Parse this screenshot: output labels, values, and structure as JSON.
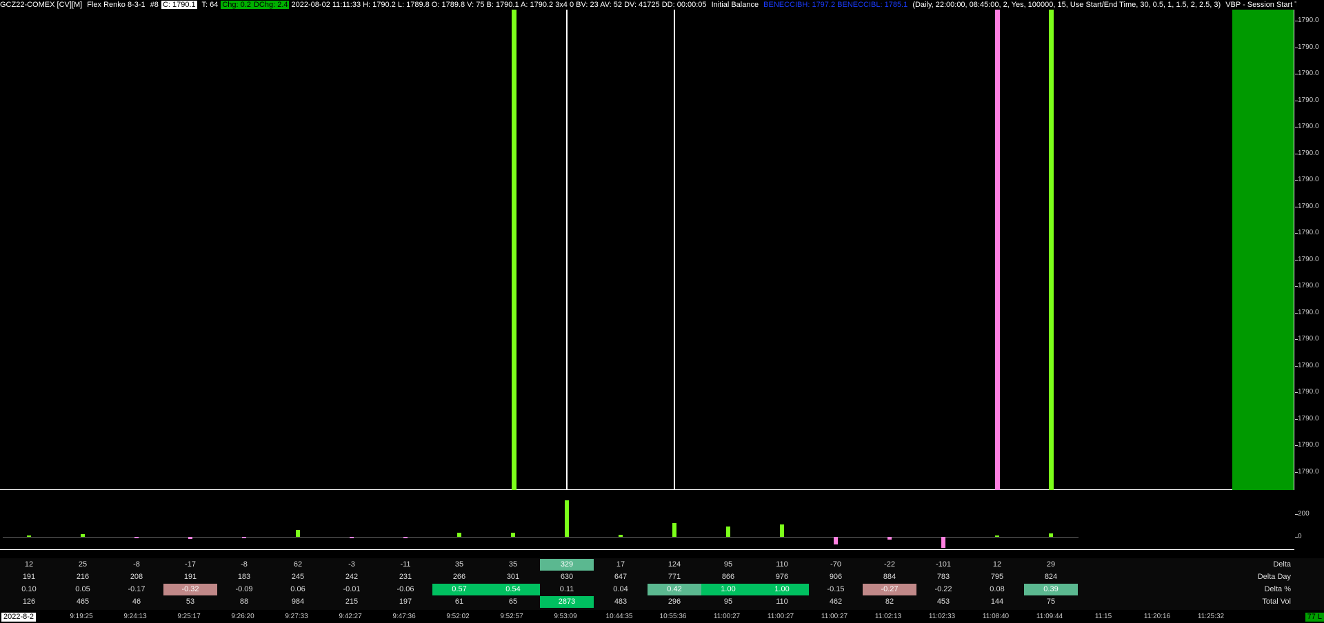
{
  "header": {
    "symbol": "GCZ22-COMEX [CV][M]",
    "chart_type": "Flex Renko 8-3-1",
    "chart_num": "#8",
    "close": "C: 1790.1",
    "ticks": "T: 64",
    "chg": "Chg: 0.2",
    "dchg": "DChg: 2.4",
    "stats": "2022-08-02 11:11:33 H: 1790.2 L: 1789.8 O: 1789.8 V: 75 B: 1790.1 A: 1790.2 3x4 0 BV: 23 AV: 52 DV: 41725 DD: 00:00:05",
    "study1": "Initial Balance",
    "study1_values": "BENECCIBH: 1797.2 BENECCIBL: 1785.1",
    "study2": "(Daily, 22:00:00, 08:45:00, 2, Yes, 100000, 15, Use Start/End Time, 30, 0.5, 1, 1.5, 2, 2.5, 3)",
    "study3": "VBP - Session Start Time to End"
  },
  "price_axis": {
    "label": "1790.0",
    "count": 18
  },
  "delta_axis": {
    "labels": [
      "200",
      "0"
    ]
  },
  "colors": {
    "up": "#7cff1a",
    "down": "#ff80e0",
    "profile": "#009a00",
    "pos_strong": "#00c060",
    "pos_weak": "#5bb890",
    "neg": "#c08888"
  },
  "table": {
    "row_labels": [
      "Delta",
      "Delta Day",
      "Delta %",
      "Total Vol"
    ],
    "columns": [
      {
        "delta": "12",
        "delta_day": "191",
        "delta_pct": "0.10",
        "total_vol": "126"
      },
      {
        "delta": "25",
        "delta_day": "216",
        "delta_pct": "0.05",
        "total_vol": "465"
      },
      {
        "delta": "-8",
        "delta_day": "208",
        "delta_pct": "-0.17",
        "total_vol": "46"
      },
      {
        "delta": "-17",
        "delta_day": "191",
        "delta_pct": "-0.32",
        "total_vol": "53",
        "pct_hl": "neg"
      },
      {
        "delta": "-8",
        "delta_day": "183",
        "delta_pct": "-0.09",
        "total_vol": "88"
      },
      {
        "delta": "62",
        "delta_day": "245",
        "delta_pct": "0.06",
        "total_vol": "984"
      },
      {
        "delta": "-3",
        "delta_day": "242",
        "delta_pct": "-0.01",
        "total_vol": "215"
      },
      {
        "delta": "-11",
        "delta_day": "231",
        "delta_pct": "-0.06",
        "total_vol": "197"
      },
      {
        "delta": "35",
        "delta_day": "266",
        "delta_pct": "0.57",
        "total_vol": "61",
        "pct_hl": "pos_strong"
      },
      {
        "delta": "35",
        "delta_day": "301",
        "delta_pct": "0.54",
        "total_vol": "65",
        "pct_hl": "pos_strong"
      },
      {
        "delta": "329",
        "delta_day": "630",
        "delta_pct": "0.11",
        "total_vol": "2873",
        "delta_hl": "pos_weak",
        "vol_hl": "pos_strong"
      },
      {
        "delta": "17",
        "delta_day": "647",
        "delta_pct": "0.04",
        "total_vol": "483"
      },
      {
        "delta": "124",
        "delta_day": "771",
        "delta_pct": "0.42",
        "total_vol": "296",
        "pct_hl": "pos_weak"
      },
      {
        "delta": "95",
        "delta_day": "866",
        "delta_pct": "1.00",
        "total_vol": "95",
        "pct_hl": "pos_strong"
      },
      {
        "delta": "110",
        "delta_day": "976",
        "delta_pct": "1.00",
        "total_vol": "110",
        "pct_hl": "pos_strong"
      },
      {
        "delta": "-70",
        "delta_day": "906",
        "delta_pct": "-0.15",
        "total_vol": "462"
      },
      {
        "delta": "-22",
        "delta_day": "884",
        "delta_pct": "-0.27",
        "total_vol": "82",
        "pct_hl": "neg"
      },
      {
        "delta": "-101",
        "delta_day": "783",
        "delta_pct": "-0.22",
        "total_vol": "453"
      },
      {
        "delta": "12",
        "delta_day": "795",
        "delta_pct": "0.08",
        "total_vol": "144"
      },
      {
        "delta": "29",
        "delta_day": "824",
        "delta_pct": "0.39",
        "total_vol": "75",
        "pct_hl": "pos_weak"
      }
    ]
  },
  "time_axis": {
    "date": "2022-8-2",
    "labels": [
      "9:19:25",
      "9:24:13",
      "9:25:17",
      "9:26:20",
      "9:27:33",
      "9:42:27",
      "9:47:36",
      "9:52:02",
      "9:52:57",
      "9:53:09",
      "10:44:35",
      "10:55:36",
      "11:00:27",
      "11:00:27",
      "11:00:27",
      "11:02:13",
      "11:02:33",
      "11:08:40",
      "11:09:44",
      "11:15",
      "11:20:16",
      "11:25:32"
    ]
  },
  "status": {
    "badge": "77 L"
  }
}
